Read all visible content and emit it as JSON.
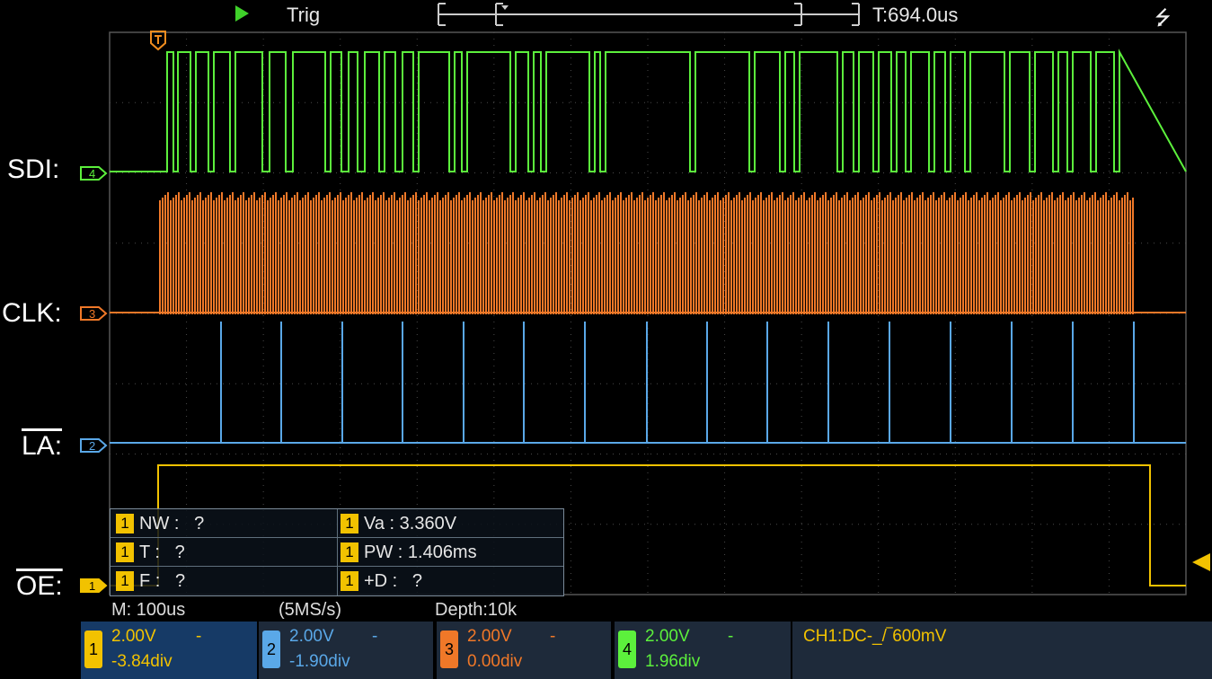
{
  "status": {
    "mode": "Trig",
    "trigger_time": "T:694.0us",
    "usb_icon": "usb-icon"
  },
  "labels": {
    "ch4": "SDI:",
    "ch3": "CLK:",
    "ch2": "LA:",
    "ch1": "OE:"
  },
  "colors": {
    "ch1": "#f2c200",
    "ch2": "#5aa8e8",
    "ch3": "#f07828",
    "ch4": "#5cf03c",
    "grid": "#4a4a4a"
  },
  "measurements": {
    "tag": "1",
    "nw": "NW :   ?",
    "va": "Va : 3.360V",
    "t": "T :   ?",
    "pw": "PW : 1.406ms",
    "f": "F :   ?",
    "pd": "+D :   ?"
  },
  "timebase": {
    "m": "M: 100us",
    "rate": "(5MS/s)",
    "depth": "Depth:10k"
  },
  "channels": [
    {
      "num": "1",
      "volts": "2.00V",
      "offset": "-3.84div",
      "dash": "-"
    },
    {
      "num": "2",
      "volts": "2.00V",
      "offset": "-1.90div",
      "dash": "-"
    },
    {
      "num": "3",
      "volts": "2.00V",
      "offset": "0.00div",
      "dash": "-"
    },
    {
      "num": "4",
      "volts": "2.00V",
      "offset": "1.96div",
      "dash": "-"
    }
  ],
  "trigger_status": "CH1:DC-_/‾600mV"
}
